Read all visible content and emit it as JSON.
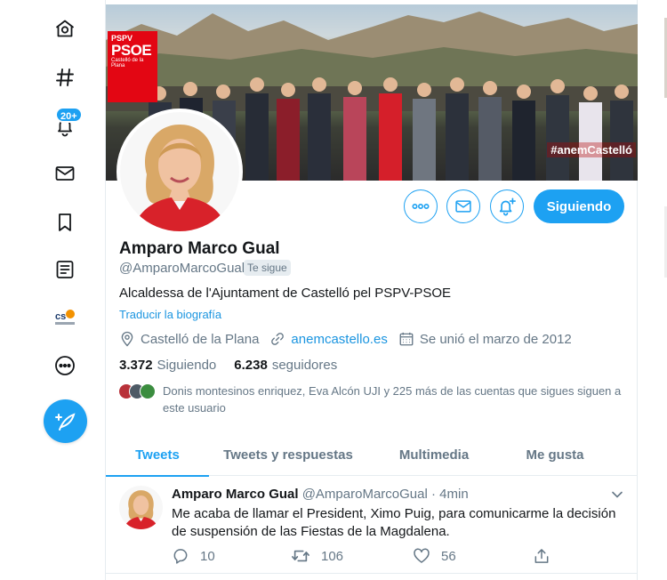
{
  "nav": {
    "notifications_badge": "20+"
  },
  "profile": {
    "name": "Amparo Marco Gual",
    "handle": "@AmparoMarcoGual",
    "follows_you": "Te sigue",
    "bio": "Alcaldessa de l'Ajuntament de Castelló pel PSPV-PSOE",
    "translate_bio": "Traducir la biografía",
    "location": "Castelló de la Plana",
    "website": "anemcastello.es",
    "joined": "Se unió el marzo de 2012",
    "following_count": "3.372",
    "following_label": "Siguiendo",
    "followers_count": "6.238",
    "followers_label": "seguidores",
    "followers_you_know": "Donis montesinos enriquez, Eva Alcón UJI y 225 más de las cuentas que sigues siguen a este usuario",
    "follow_button": "Siguiendo"
  },
  "banner": {
    "sign_top": "PSPV",
    "sign_main": "PSOE",
    "sign_sub": "Castelló de la Plana",
    "hashtag": "#anemCastelló"
  },
  "tabs": [
    {
      "label": "Tweets",
      "active": true
    },
    {
      "label": "Tweets y respuestas",
      "active": false
    },
    {
      "label": "Multimedia",
      "active": false
    },
    {
      "label": "Me gusta",
      "active": false
    }
  ],
  "tweet": {
    "author_name": "Amparo Marco Gual",
    "author_handle": "@AmparoMarcoGual",
    "separator": "·",
    "time": "4min",
    "text": "Me acaba de llamar el President, Ximo Puig, para comunicarme la decisión de suspensión de las Fiestas de la Magdalena.",
    "replies": "10",
    "retweets": "106",
    "likes": "56"
  },
  "colors": {
    "accent": "#1da1f2",
    "link": "#1b95e0",
    "secondary_text": "#657786",
    "primary_text": "#14171a",
    "border": "#e6ecf0",
    "party_red": "#e30613"
  }
}
